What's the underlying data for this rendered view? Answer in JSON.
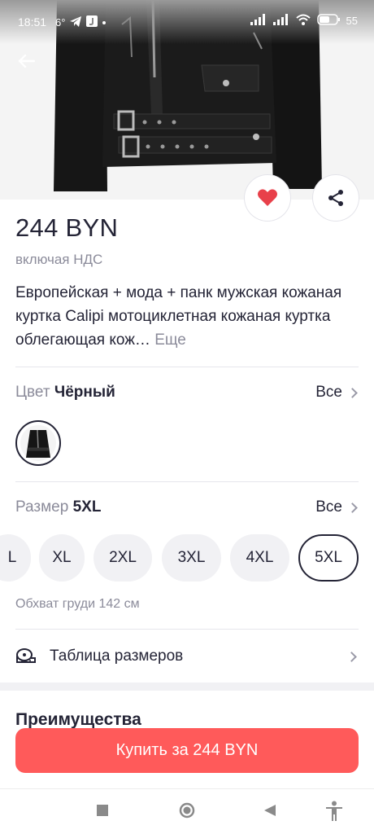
{
  "status_bar": {
    "time": "18:51",
    "temp": "6°",
    "battery": "55"
  },
  "product": {
    "price": "244 BYN",
    "vat_note": "включая НДС",
    "description": "Европейская + мода + панк мужская кожаная куртка Calipi мотоциклетная кожаная куртка облегающая кож…",
    "more_label": "Еще"
  },
  "color_row": {
    "label": "Цвет",
    "value": "Чёрный",
    "all_label": "Все"
  },
  "size_row": {
    "label": "Размер",
    "value": "5XL",
    "all_label": "Все",
    "options": [
      "L",
      "XL",
      "2XL",
      "3XL",
      "4XL",
      "5XL"
    ],
    "selected": "5XL"
  },
  "chest_info": "Обхват груди 142 см",
  "size_table_label": "Таблица размеров",
  "advantages_title": "Преимущества",
  "buy_button": "Купить за 244 BYN",
  "colors": {
    "accent": "#ff5a5a",
    "heart": "#e8404a",
    "text_primary": "#242436",
    "text_secondary": "#8b8b9a"
  }
}
